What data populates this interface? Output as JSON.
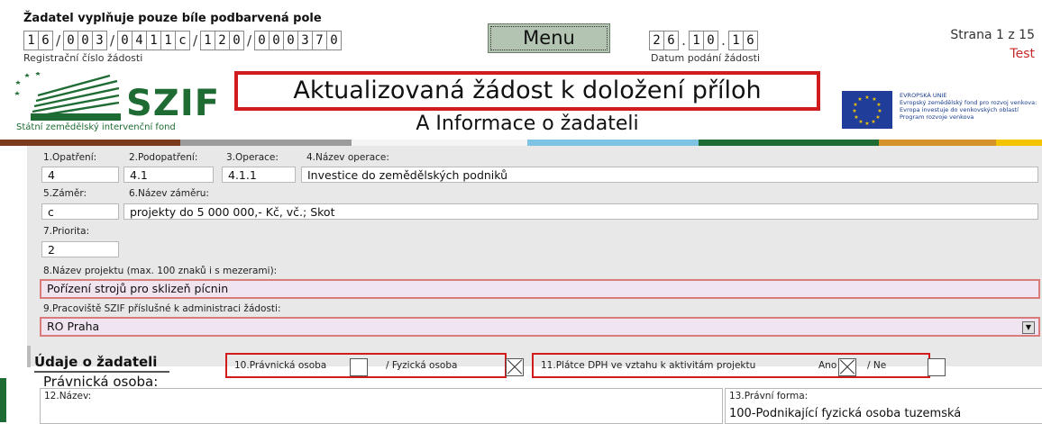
{
  "header": {
    "note": "Žadatel vyplňuje pouze bíle podbarvená pole",
    "reg_label": "Registrační číslo žádosti",
    "reg_groups": [
      [
        "1",
        "6"
      ],
      [
        "0",
        "0",
        "3"
      ],
      [
        "0",
        "4",
        "1",
        "1",
        "c"
      ],
      [
        "1",
        "2",
        "0"
      ],
      [
        "0",
        "0",
        "0",
        "3",
        "7",
        "0"
      ]
    ],
    "reg_separators": [
      "/",
      "/",
      "/",
      "/"
    ],
    "menu_label": "Menu",
    "date_groups": [
      [
        "2",
        "6"
      ],
      [
        "1",
        "0"
      ],
      [
        "1",
        "6"
      ]
    ],
    "date_separators": [
      ".",
      "."
    ],
    "date_label": "Datum podání žádosti",
    "page_label": "Strana 1 z 15",
    "test_label": "Test"
  },
  "logo": {
    "name": "SZIF",
    "subtitle": "Státní zemědělský intervenční fond"
  },
  "title": {
    "main": "Aktualizovaná žádost k doložení příloh",
    "sub": "A Informace o žadateli"
  },
  "eu": {
    "line1": "EVROPSKÁ UNIE",
    "line2": "Evropský zemědělský fond pro rozvoj venkova:",
    "line3": "Evropa investuje do venkovských oblastí",
    "line4": "Program rozvoje venkova"
  },
  "colors": {
    "bar": [
      "#7a3b1c",
      "#9b9b9b",
      "#f4f4f4",
      "#7ec3e3",
      "#1e6b33",
      "#d6922a",
      "#f2c500"
    ],
    "accent_red": "#d01c1c",
    "brand_green": "#1e6b33"
  },
  "form": {
    "opatreni_label": "1.Opatření:",
    "opatreni_value": "4",
    "podopatreni_label": "2.Podopatření:",
    "podopatreni_value": "4.1",
    "operace_label": "3.Operace:",
    "operace_value": "4.1.1",
    "nazev_operace_label": "4.Název operace:",
    "nazev_operace_value": "Investice do zemědělských podniků",
    "zamer_label": "5.Záměr:",
    "zamer_value": "c",
    "nazev_zameru_label": "6.Název záměru:",
    "nazev_zameru_value": "projekty do 5 000 000,- Kč, vč.; Skot",
    "priorita_label": "7.Priorita:",
    "priorita_value": "2",
    "nazev_projektu_label": "8.Název projektu (max. 100 znaků i s mezerami):",
    "nazev_projektu_value": "Pořízení strojů pro sklizeň pícnin",
    "pracoviste_label": "9.Pracoviště SZIF příslušné k administraci žádosti:",
    "pracoviste_value": "RO Praha"
  },
  "applicant": {
    "section_title": "Údaje o žadateli",
    "pravnicka_label": "10.Právnická osoba",
    "fyzicka_label": "/  Fyzická osoba",
    "dph_label": "11.Plátce DPH ve vztahu k aktivitám projektu",
    "ano_label": "Ano",
    "ne_label": "/  Ne",
    "person_type": "Právnická osoba:",
    "nazev_label": "12.Název:",
    "pravni_forma_label": "13.Právní forma:",
    "pravni_forma_value": "100-Podnikající fyzická osoba tuzemská"
  }
}
